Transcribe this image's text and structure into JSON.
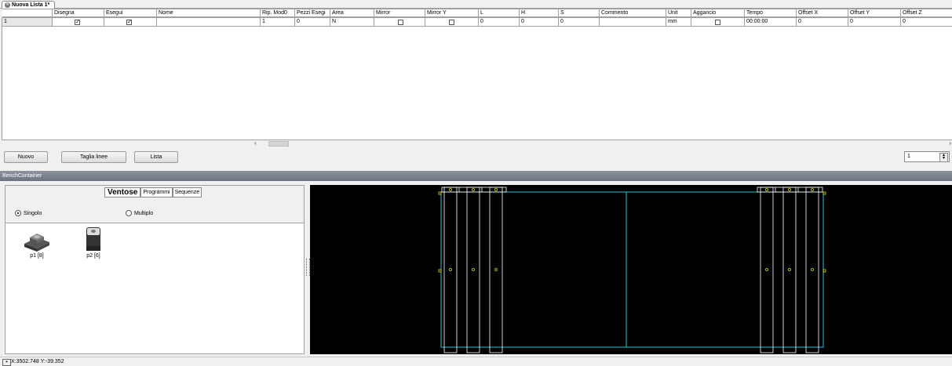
{
  "tab": {
    "title": "Nuova Lista 1*"
  },
  "grid": {
    "columns": [
      {
        "label": "",
        "w": 64
      },
      {
        "label": "Disegna",
        "w": 66
      },
      {
        "label": "Esegui",
        "w": 67
      },
      {
        "label": "Nome",
        "w": 132
      },
      {
        "label": "Rip. Mod0",
        "w": 44
      },
      {
        "label": "Pezzi Esegi",
        "w": 45
      },
      {
        "label": "Area",
        "w": 56
      },
      {
        "label": "Mirror",
        "w": 65
      },
      {
        "label": "Mirror Y",
        "w": 68
      },
      {
        "label": "L",
        "w": 52
      },
      {
        "label": "H",
        "w": 50
      },
      {
        "label": "S",
        "w": 52
      },
      {
        "label": "Commento",
        "w": 85
      },
      {
        "label": "Unit",
        "w": 32
      },
      {
        "label": "Aggancio",
        "w": 68
      },
      {
        "label": "Tempo",
        "w": 66
      },
      {
        "label": "Offset X",
        "w": 66
      },
      {
        "label": "Offset Y",
        "w": 67
      },
      {
        "label": "Offset Z",
        "w": 66
      }
    ],
    "rows": [
      [
        "1",
        "☑",
        "☑",
        "",
        "1",
        "0",
        "N",
        "☐",
        "☐",
        "0",
        "0",
        "0",
        "",
        "mm",
        "☐",
        "00:00:00",
        "0",
        "0",
        "0"
      ]
    ]
  },
  "buttons": {
    "nuovo": "Nuovo",
    "taglia": "Taglia linee",
    "lista": "Lista"
  },
  "spinner": {
    "value": "1"
  },
  "bench": {
    "title": "BenchContainer"
  },
  "panel": {
    "tabs": [
      "Ventose",
      "Programmi",
      "Sequenze"
    ],
    "radio_singolo": "Singolo",
    "radio_multiplo": "Multiplo",
    "items": [
      {
        "label": "p1 [8]",
        "icon": "suction-cup-pad-icon"
      },
      {
        "label": "p2 [6]",
        "icon": "suction-cup-block-icon"
      }
    ]
  },
  "status": {
    "coords": "X:3502.748 Y:-39.352"
  },
  "colors": {
    "canvas_bg": "#000000",
    "cyan_line": "#29c4d6",
    "yellow_marker": "#e6e000",
    "white_line": "#ffffff"
  }
}
